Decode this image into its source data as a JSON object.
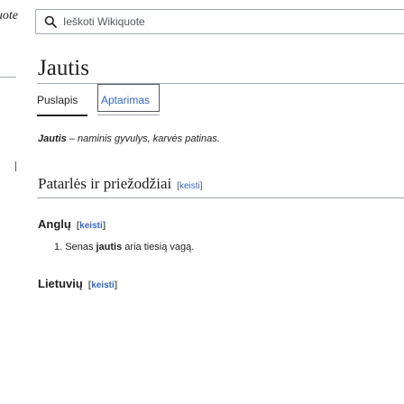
{
  "sidebar": {
    "logo_text": "iquote"
  },
  "search": {
    "placeholder": "Ieškoti Wikiquote",
    "value": ""
  },
  "page": {
    "title": "Jautis"
  },
  "tabs": [
    {
      "label": "Puslapis",
      "selected": true
    },
    {
      "label": "Aptarimas",
      "selected": false
    }
  ],
  "intro": {
    "term": "Jautis",
    "text": " – naminis gyvulys, karvės patinas."
  },
  "sections": {
    "proverbs": {
      "heading": "Patarlės ir priežodžiai",
      "edit_label": "keisti"
    },
    "english": {
      "heading": "Anglų",
      "edit_label": "keisti",
      "items": [
        {
          "number": "1.",
          "before": "Senas ",
          "bold": "jautis",
          "after": " aria tiesią vagą."
        }
      ]
    },
    "lithuanian": {
      "heading": "Lietuvių",
      "edit_label": "keisti"
    }
  },
  "colors": {
    "link": "#3366cc",
    "text": "#202122",
    "border": "#a2a9b1",
    "muted": "#54595d"
  }
}
